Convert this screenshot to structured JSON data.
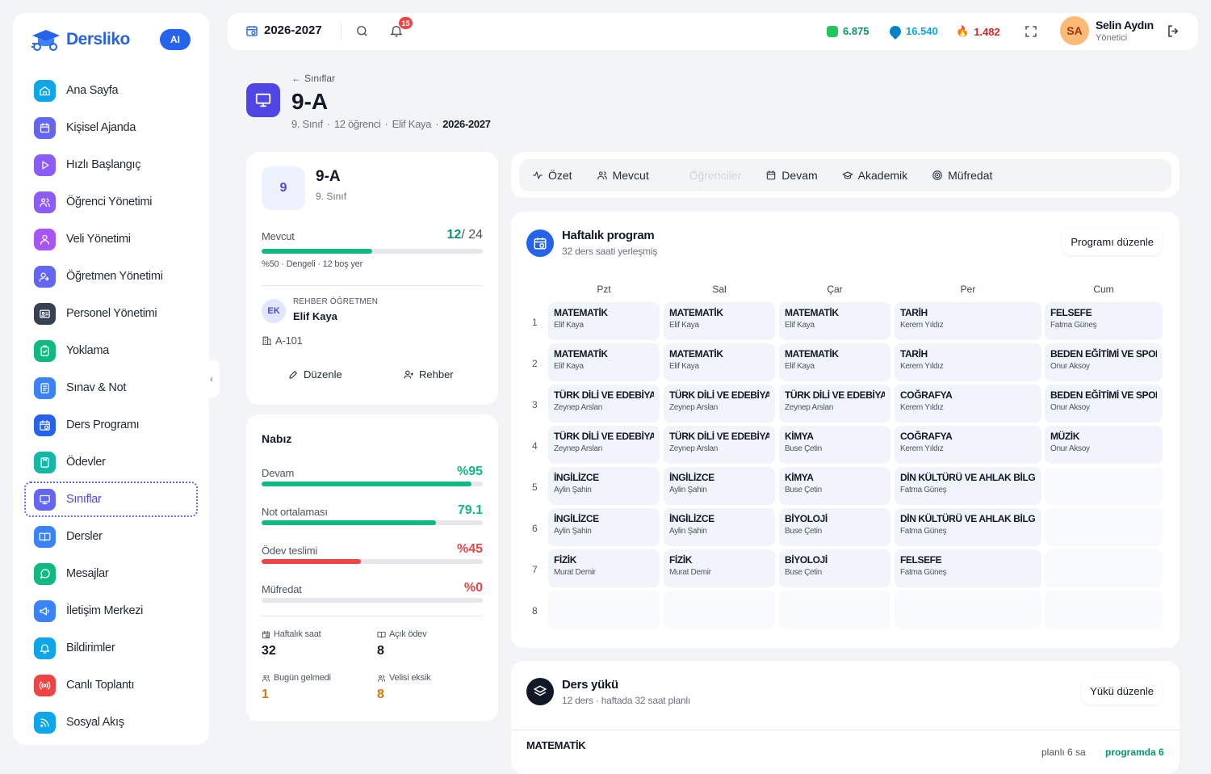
{
  "brand": {
    "name": "Dersliko",
    "ai_label": "AI"
  },
  "sidebar": {
    "items": [
      {
        "label": "Ana Sayfa",
        "icon": "home-icon",
        "color": "#0ea5e9"
      },
      {
        "label": "Kişisel Ajanda",
        "icon": "agenda-icon",
        "color": "#6366f1"
      },
      {
        "label": "Hızlı Başlangıç",
        "icon": "play-icon",
        "color": "#8b5cf6"
      },
      {
        "label": "Öğrenci Yönetimi",
        "icon": "students-icon",
        "color": "#8b5cf6"
      },
      {
        "label": "Veli Yönetimi",
        "icon": "parents-icon",
        "color": "#a855f7"
      },
      {
        "label": "Öğretmen Yönetimi",
        "icon": "teachers-icon",
        "color": "#6366f1"
      },
      {
        "label": "Personel Yönetimi",
        "icon": "id-card-icon",
        "color": "#374151"
      },
      {
        "label": "Yoklama",
        "icon": "clipboard-check-icon",
        "color": "#10b981"
      },
      {
        "label": "Sınav & Not",
        "icon": "exam-icon",
        "color": "#3b82f6"
      },
      {
        "label": "Ders Programı",
        "icon": "calendar-clock-icon",
        "color": "#2563eb"
      },
      {
        "label": "Ödevler",
        "icon": "homework-icon",
        "color": "#14b8a6"
      },
      {
        "label": "Sınıflar",
        "icon": "presentation-icon",
        "color": "#6366f1",
        "active": true
      },
      {
        "label": "Dersler",
        "icon": "book-open-icon",
        "color": "#3b82f6"
      },
      {
        "label": "Mesajlar",
        "icon": "message-icon",
        "color": "#10b981"
      },
      {
        "label": "İletişim Merkezi",
        "icon": "megaphone-icon",
        "color": "#3b82f6"
      },
      {
        "label": "Bildirimler",
        "icon": "bell-icon",
        "color": "#0ea5e9"
      },
      {
        "label": "Canlı Toplantı",
        "icon": "broadcast-icon",
        "color": "#ef4444"
      },
      {
        "label": "Sosyal Akış",
        "icon": "rss-icon",
        "color": "#0ea5e9"
      }
    ]
  },
  "topbar": {
    "year": "2026-2027",
    "notification_count": "15",
    "stats": [
      {
        "value": "6.875",
        "color": "#059669",
        "icon": "gem-green-icon"
      },
      {
        "value": "16.540",
        "color": "#0ea5e9",
        "icon": "gem-blue-icon"
      },
      {
        "value": "1.482",
        "color": "#dc2626",
        "icon": "fire-icon"
      }
    ],
    "user": {
      "initials": "SA",
      "name": "Selin Aydın",
      "role": "Yönetici"
    }
  },
  "page": {
    "back_label": "Sınıflar",
    "title": "9-A",
    "meta": {
      "grade": "9. Sınıf",
      "students": "12 öğrenci",
      "teacher": "Elif Kaya",
      "year": "2026-2027"
    }
  },
  "class_card": {
    "grade_number": "9",
    "title": "9-A",
    "subtitle": "9. Sınıf",
    "capacity_label": "Mevcut",
    "current": "12",
    "max": "/ 24",
    "fill": 0.5,
    "capacity_note": "%50 · Dengeli · 12 boş yer",
    "teacher_heading": "REHBER ÖĞRETMEN",
    "teacher_initials": "EK",
    "teacher_name": "Elif Kaya",
    "room": "A-101",
    "edit_label": "Düzenle",
    "guide_label": "Rehber"
  },
  "pulse": {
    "title": "Nabız",
    "metrics": [
      {
        "label": "Devam",
        "value": "%95",
        "fill": 0.95,
        "color": "#10b981"
      },
      {
        "label": "Not ortalaması",
        "value": "79.1",
        "fill": 0.79,
        "color": "#10b981"
      },
      {
        "label": "Ödev teslimi",
        "value": "%45",
        "fill": 0.45,
        "color": "#ef4444"
      },
      {
        "label": "Müfredat",
        "value": "%0",
        "fill": 0,
        "color": "#ef4444"
      }
    ],
    "minis": [
      {
        "label": "Haftalık saat",
        "value": "32",
        "color": "#111827"
      },
      {
        "label": "Açık ödev",
        "value": "8",
        "color": "#111827"
      },
      {
        "label": "Bugün gelmedi",
        "value": "1",
        "color": "#d97706"
      },
      {
        "label": "Velisi eksik",
        "value": "8",
        "color": "#d97706"
      }
    ]
  },
  "tabs": [
    {
      "label": "Özet",
      "icon": "pulse-icon"
    },
    {
      "label": "Mevcut",
      "icon": "users-icon"
    },
    {
      "label": "Öğrenciler",
      "icon": "blank-icon",
      "ghost": true
    },
    {
      "label": "Devam",
      "icon": "calendar-icon"
    },
    {
      "label": "Akademik",
      "icon": "graduation-cap-icon"
    },
    {
      "label": "Müfredat",
      "icon": "target-icon"
    }
  ],
  "schedule": {
    "title": "Haftalık program",
    "subtitle": "32 ders saati yerleşmiş",
    "edit_label": "Programı düzenle",
    "days": [
      "Pzt",
      "Sal",
      "Çar",
      "Per",
      "Cum"
    ],
    "periods": [
      "1",
      "2",
      "3",
      "4",
      "5",
      "6",
      "7",
      "8"
    ],
    "grid": [
      [
        [
          "MATEMATİK",
          "Elif Kaya"
        ],
        [
          "MATEMATİK",
          "Elif Kaya"
        ],
        [
          "MATEMATİK",
          "Elif Kaya"
        ],
        [
          "TARİH",
          "Kerem Yıldız"
        ],
        [
          "FELSEFE",
          "Fatma Güneş"
        ]
      ],
      [
        [
          "MATEMATİK",
          "Elif Kaya"
        ],
        [
          "MATEMATİK",
          "Elif Kaya"
        ],
        [
          "MATEMATİK",
          "Elif Kaya"
        ],
        [
          "TARİH",
          "Kerem Yıldız"
        ],
        [
          "BEDEN EĞİTİMİ VE SPOR",
          "Onur Aksoy"
        ]
      ],
      [
        [
          "TÜRK DİLİ VE EDEBİYATI",
          "Zeynep Arslan"
        ],
        [
          "TÜRK DİLİ VE EDEBİYATI",
          "Zeynep Arslan"
        ],
        [
          "TÜRK DİLİ VE EDEBİYATI",
          "Zeynep Arslan"
        ],
        [
          "COĞRAFYA",
          "Kerem Yıldız"
        ],
        [
          "BEDEN EĞİTİMİ VE SPOR",
          "Onur Aksoy"
        ]
      ],
      [
        [
          "TÜRK DİLİ VE EDEBİYATI",
          "Zeynep Arslan"
        ],
        [
          "TÜRK DİLİ VE EDEBİYATI",
          "Zeynep Arslan"
        ],
        [
          "KİMYA",
          "Buse Çetin"
        ],
        [
          "COĞRAFYA",
          "Kerem Yıldız"
        ],
        [
          "MÜZİK",
          "Onur Aksoy"
        ]
      ],
      [
        [
          "İNGİLİZCE",
          "Aylin Şahin"
        ],
        [
          "İNGİLİZCE",
          "Aylin Şahin"
        ],
        [
          "KİMYA",
          "Buse Çetin"
        ],
        [
          "DİN KÜLTÜRÜ VE AHLAK BİLGİSİ",
          "Fatma Güneş"
        ],
        null
      ],
      [
        [
          "İNGİLİZCE",
          "Aylin Şahin"
        ],
        [
          "İNGİLİZCE",
          "Aylin Şahin"
        ],
        [
          "BİYOLOJİ",
          "Buse Çetin"
        ],
        [
          "DİN KÜLTÜRÜ VE AHLAK BİLGİSİ",
          "Fatma Güneş"
        ],
        null
      ],
      [
        [
          "FİZİK",
          "Murat Demir"
        ],
        [
          "FİZİK",
          "Murat Demir"
        ],
        [
          "BİYOLOJİ",
          "Buse Çetin"
        ],
        [
          "FELSEFE",
          "Fatma Güneş"
        ],
        null
      ],
      [
        null,
        null,
        null,
        null,
        null
      ]
    ]
  },
  "load": {
    "title": "Ders yükü",
    "subtitle": "12 ders · haftada 32 saat planlı",
    "edit_label": "Yükü düzenle",
    "first_subject": "MATEMATİK",
    "planned": "planlı 6 sa",
    "scheduled": "programda 6"
  }
}
